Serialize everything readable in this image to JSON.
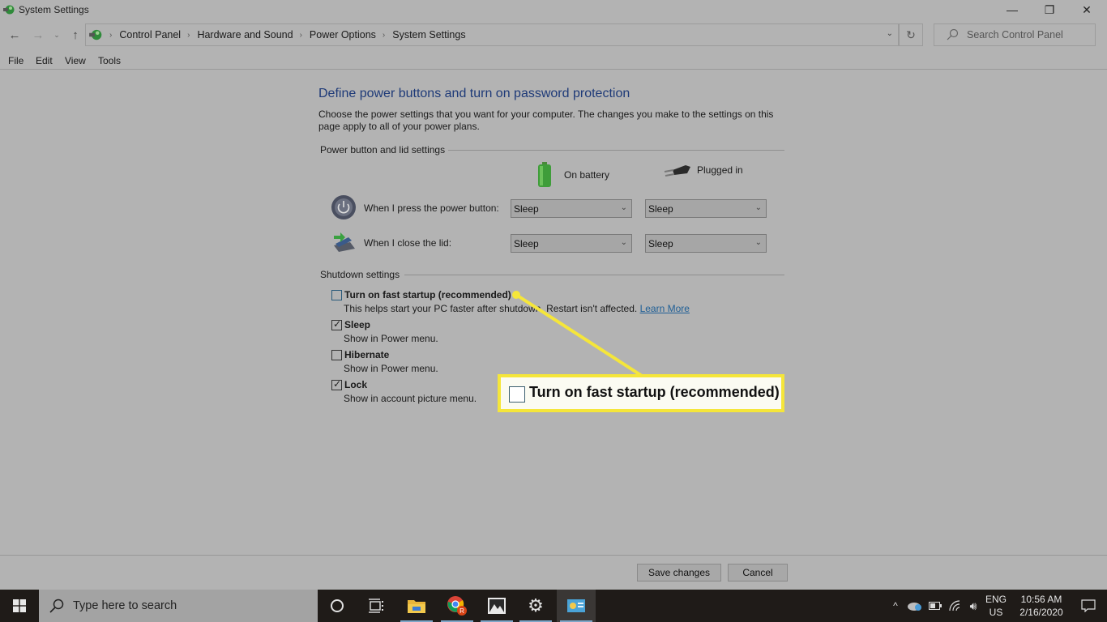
{
  "window": {
    "title": "System Settings",
    "controls": {
      "minimize": "—",
      "maximize": "❐",
      "close": "✕"
    }
  },
  "address": {
    "breadcrumbs": [
      "Control Panel",
      "Hardware and Sound",
      "Power Options",
      "System Settings"
    ],
    "search_placeholder": "Search Control Panel"
  },
  "menu": [
    "File",
    "Edit",
    "View",
    "Tools"
  ],
  "page": {
    "title": "Define power buttons and turn on password protection",
    "description": "Choose the power settings that you want for your computer. The changes you make to the settings on this page apply to all of your power plans.",
    "power_group_label": "Power button and lid settings",
    "columns": {
      "battery": "On battery",
      "plugged": "Plugged in"
    },
    "rows": [
      {
        "label": "When I press the power button:",
        "battery": "Sleep",
        "plugged": "Sleep"
      },
      {
        "label": "When I close the lid:",
        "battery": "Sleep",
        "plugged": "Sleep"
      }
    ],
    "shutdown_group_label": "Shutdown settings",
    "shutdown_options": [
      {
        "label": "Turn on fast startup (recommended)",
        "checked": false,
        "description": "This helps start your PC faster after shutdown. Restart isn't affected.",
        "link": "Learn More"
      },
      {
        "label": "Sleep",
        "checked": true,
        "description": "Show in Power menu."
      },
      {
        "label": "Hibernate",
        "checked": false,
        "description": "Show in Power menu."
      },
      {
        "label": "Lock",
        "checked": true,
        "description": "Show in account picture menu."
      }
    ],
    "callout": {
      "label": "Turn on fast startup (recommended)",
      "color": "#f5e63a"
    }
  },
  "buttons": {
    "save": "Save changes",
    "cancel": "Cancel"
  },
  "taskbar": {
    "search_placeholder": "Type here to search",
    "apps": [
      "cortana",
      "task-view",
      "file-explorer",
      "chrome",
      "photos",
      "settings",
      "control-panel"
    ],
    "language": {
      "line1": "ENG",
      "line2": "US"
    },
    "time": "10:56 AM",
    "date": "2/16/2020"
  },
  "tick_glyph": "✓"
}
